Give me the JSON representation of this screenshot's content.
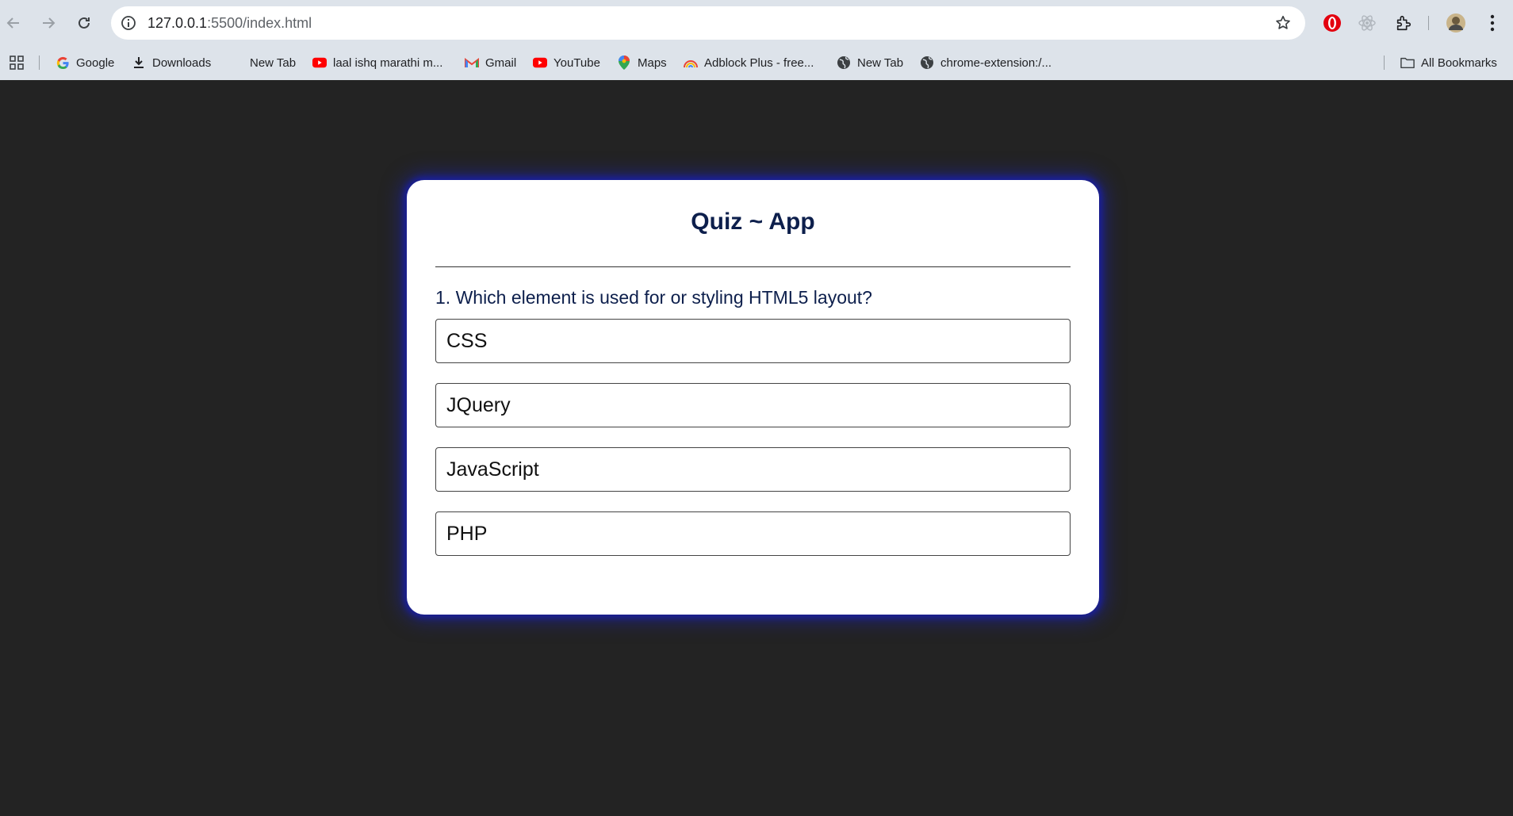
{
  "browser": {
    "url_host": "127.0.0.1",
    "url_path": ":5500/index.html",
    "bookmarks": [
      {
        "label": "Google",
        "icon": "google-icon"
      },
      {
        "label": "Downloads",
        "icon": "download-icon"
      },
      {
        "label": "New Tab",
        "icon": "blank-icon"
      },
      {
        "label": "laal ishq marathi m...",
        "icon": "youtube-icon"
      },
      {
        "label": "Gmail",
        "icon": "gmail-icon"
      },
      {
        "label": "YouTube",
        "icon": "youtube-icon"
      },
      {
        "label": "Maps",
        "icon": "maps-icon"
      },
      {
        "label": "Adblock Plus - free...",
        "icon": "rainbow-icon"
      },
      {
        "label": "New Tab",
        "icon": "globe-icon"
      },
      {
        "label": "chrome-extension:/...",
        "icon": "globe-icon"
      }
    ],
    "all_bookmarks": "All Bookmarks"
  },
  "quiz": {
    "title": "Quiz ~ App",
    "question": "1. Which element is used for or styling HTML5 layout?",
    "options": [
      "CSS",
      "JQuery",
      "JavaScript",
      "PHP"
    ]
  },
  "colors": {
    "page_bg": "#232323",
    "card_glow": "#1a1f9a",
    "title_text": "#0d1f4c"
  }
}
